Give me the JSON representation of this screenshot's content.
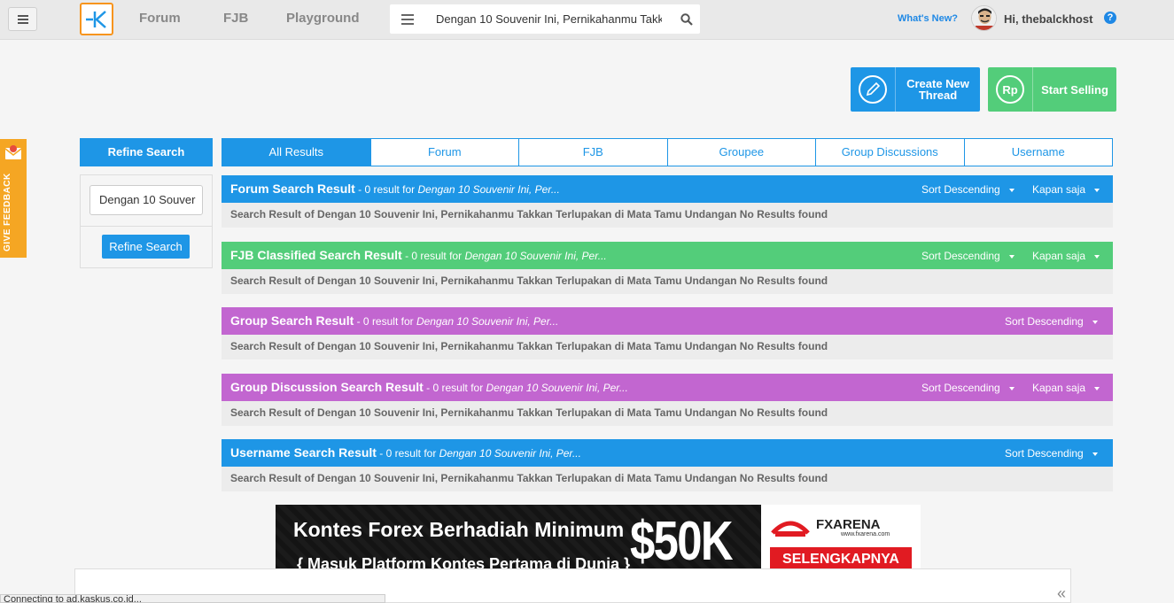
{
  "nav": {
    "links": [
      "Forum",
      "FJB",
      "Playground"
    ],
    "search_value": "Dengan 10 Souvenir Ini, Pernikahanmu Takk",
    "whats_new": "What's New?",
    "greeting": "Hi, thebalckhost",
    "help": "?"
  },
  "actions": {
    "create_thread": "Create New Thread",
    "start_selling": "Start Selling",
    "rp_label": "Rp"
  },
  "feedback": {
    "label": "GIVE FEEDBACK"
  },
  "refine": {
    "header": "Refine Search",
    "input_value": "Dengan 10 Souver",
    "button": "Refine Search"
  },
  "tabs": [
    "All Results",
    "Forum",
    "FJB",
    "Groupee",
    "Group Discussions",
    "Username"
  ],
  "results": [
    {
      "title": "Forum Search Result",
      "count": " - 0 result for ",
      "query": "Dengan 10 Souvenir Ini, Per...",
      "sort": "Sort Descending",
      "time": "Kapan saja",
      "body": "Search Result of Dengan 10 Souvenir Ini, Pernikahanmu Takkan Terlupakan di Mata Tamu Undangan No Results found",
      "color": "#1e96e6"
    },
    {
      "title": "FJB Classified Search Result",
      "count": " - 0 result for ",
      "query": "Dengan 10 Souvenir Ini, Per...",
      "sort": "Sort Descending",
      "time": "Kapan saja",
      "body": "Search Result of Dengan 10 Souvenir Ini, Pernikahanmu Takkan Terlupakan di Mata Tamu Undangan No Results found",
      "color": "#53cd7a"
    },
    {
      "title": "Group Search Result",
      "count": " - 0 result for ",
      "query": "Dengan 10 Souvenir Ini, Per...",
      "sort": "Sort Descending",
      "time": "",
      "body": "Search Result of Dengan 10 Souvenir Ini, Pernikahanmu Takkan Terlupakan di Mata Tamu Undangan No Results found",
      "color": "#c266d0"
    },
    {
      "title": "Group Discussion Search Result",
      "count": " - 0 result for ",
      "query": "Dengan 10 Souvenir Ini, Per...",
      "sort": "Sort Descending",
      "time": "Kapan saja",
      "body": "Search Result of Dengan 10 Souvenir Ini, Pernikahanmu Takkan Terlupakan di Mata Tamu Undangan No Results found",
      "color": "#c266d0"
    },
    {
      "title": "Username Search Result",
      "count": " - 0 result for ",
      "query": "Dengan 10 Souvenir Ini, Per...",
      "sort": "Sort Descending",
      "time": "",
      "body": "Search Result of Dengan 10 Souvenir Ini, Pernikahanmu Takkan Terlupakan di Mata Tamu Undangan No Results found",
      "color": "#1e96e6"
    }
  ],
  "ad": {
    "line1": "Kontes Forex Berhadiah Minimum",
    "line2": "{ Masuk Platform Kontes Pertama di Dunia }",
    "amount": "$50K",
    "brand": "FXARENA",
    "url": "www.fxarena.com",
    "cta": "SELENGKAPNYA"
  },
  "status": "Connecting to ad.kaskus.co.id...",
  "colors": {
    "primary": "#1e96e6",
    "green": "#53cd7a",
    "purple": "#c266d0",
    "orange": "#f5a623",
    "logo_orange": "#f7941d"
  }
}
